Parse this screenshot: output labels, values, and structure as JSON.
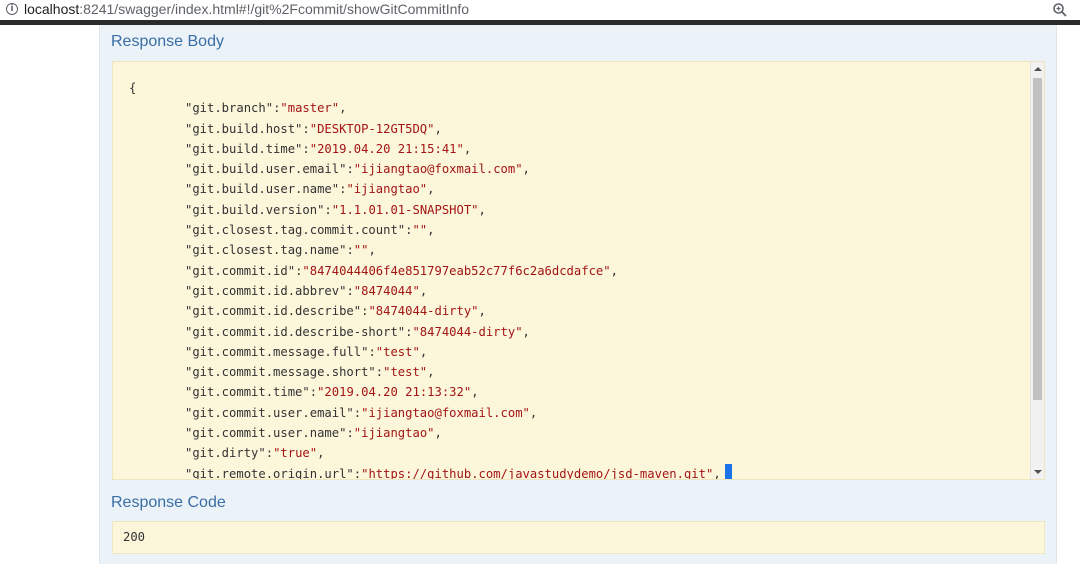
{
  "browser": {
    "url_host": "localhost",
    "url_path": ":8241/swagger/index.html#!/git%2Fcommit/showGitCommitInfo",
    "info_icon": "info-icon",
    "zoom_icon": "zoom-icon"
  },
  "response_body": {
    "title": "Response Body",
    "open_brace": "{",
    "entries": [
      {
        "key": "\"git.branch\"",
        "value": "\"master\""
      },
      {
        "key": "\"git.build.host\"",
        "value": "\"DESKTOP-12GT5DQ\""
      },
      {
        "key": "\"git.build.time\"",
        "value": "\"2019.04.20 21:15:41\""
      },
      {
        "key": "\"git.build.user.email\"",
        "value": "\"ijiangtao@foxmail.com\""
      },
      {
        "key": "\"git.build.user.name\"",
        "value": "\"ijiangtao\""
      },
      {
        "key": "\"git.build.version\"",
        "value": "\"1.1.01.01-SNAPSHOT\""
      },
      {
        "key": "\"git.closest.tag.commit.count\"",
        "value": "\"\""
      },
      {
        "key": "\"git.closest.tag.name\"",
        "value": "\"\""
      },
      {
        "key": "\"git.commit.id\"",
        "value": "\"8474044406f4e851797eab52c77f6c2a6dcdafce\""
      },
      {
        "key": "\"git.commit.id.abbrev\"",
        "value": "\"8474044\""
      },
      {
        "key": "\"git.commit.id.describe\"",
        "value": "\"8474044-dirty\""
      },
      {
        "key": "\"git.commit.id.describe-short\"",
        "value": "\"8474044-dirty\""
      },
      {
        "key": "\"git.commit.message.full\"",
        "value": "\"test\""
      },
      {
        "key": "\"git.commit.message.short\"",
        "value": "\"test\""
      },
      {
        "key": "\"git.commit.time\"",
        "value": "\"2019.04.20 21:13:32\""
      },
      {
        "key": "\"git.commit.user.email\"",
        "value": "\"ijiangtao@foxmail.com\""
      },
      {
        "key": "\"git.commit.user.name\"",
        "value": "\"ijiangtao\""
      },
      {
        "key": "\"git.dirty\"",
        "value": "\"true\""
      },
      {
        "key": "\"git.remote.origin.url\"",
        "value": "\"https://github.com/javastudydemo/jsd-maven.git\""
      }
    ]
  },
  "response_code": {
    "title": "Response Code",
    "value": "200"
  }
}
